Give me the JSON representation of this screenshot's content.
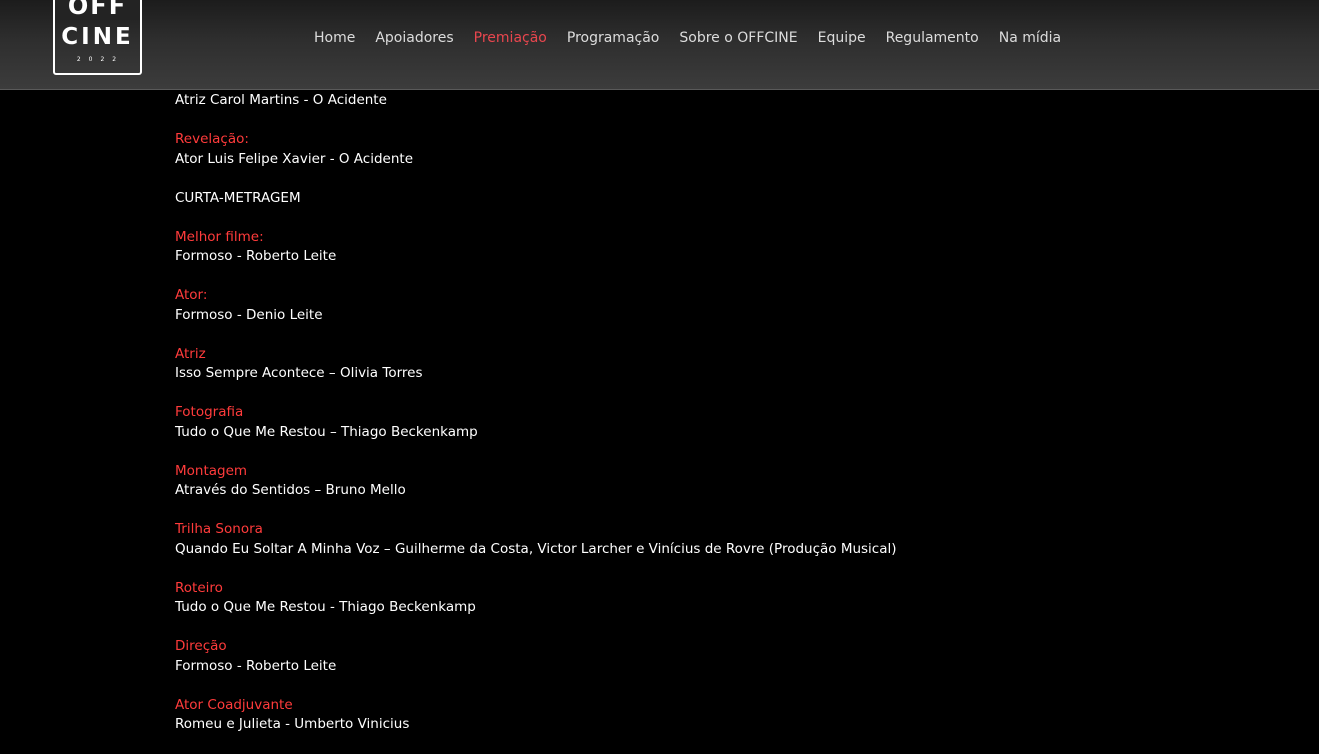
{
  "logo": {
    "top": "OFF",
    "bottom": "CINE",
    "year": "2022"
  },
  "nav": {
    "items": [
      {
        "label": "Home",
        "active": false
      },
      {
        "label": "Apoiadores",
        "active": false
      },
      {
        "label": "Premiação",
        "active": true
      },
      {
        "label": "Programação",
        "active": false
      },
      {
        "label": "Sobre o OFFCINE",
        "active": false
      },
      {
        "label": "Equipe",
        "active": false
      },
      {
        "label": "Regulamento",
        "active": false
      },
      {
        "label": "Na mídia",
        "active": false
      }
    ]
  },
  "colors": {
    "accent": "#e8464e",
    "category": "#ff3b3b",
    "text": "#ffffff",
    "background": "#000000"
  },
  "content": {
    "top_line": "Atriz Carol Martins - O Acidente",
    "revelacao": {
      "category": "Revelação:",
      "winner": "Ator Luis Felipe Xavier - O Acidente"
    },
    "section_heading": "CURTA-METRAGEM",
    "awards": [
      {
        "category": "Melhor filme:",
        "winner": "Formoso - Roberto Leite"
      },
      {
        "category": "Ator:",
        "winner": "Formoso - Denio Leite"
      },
      {
        "category": "Atriz",
        "winner": "Isso Sempre Acontece – Olivia Torres"
      },
      {
        "category": "Fotografia",
        "winner": "Tudo o Que Me Restou – Thiago Beckenkamp"
      },
      {
        "category": "Montagem",
        "winner": "Através do Sentidos – Bruno Mello"
      },
      {
        "category": "Trilha Sonora",
        "winner": "Quando Eu Soltar A Minha Voz – Guilherme da Costa, Victor Larcher e Vinícius de Rovre (Produção Musical)"
      },
      {
        "category": "Roteiro",
        "winner": "Tudo o Que Me Restou - Thiago Beckenkamp"
      },
      {
        "category": "Direção",
        "winner": "Formoso - Roberto Leite"
      },
      {
        "category": "Ator Coadjuvante",
        "winner": "Romeu e Julieta - Umberto Vinicius"
      }
    ]
  }
}
